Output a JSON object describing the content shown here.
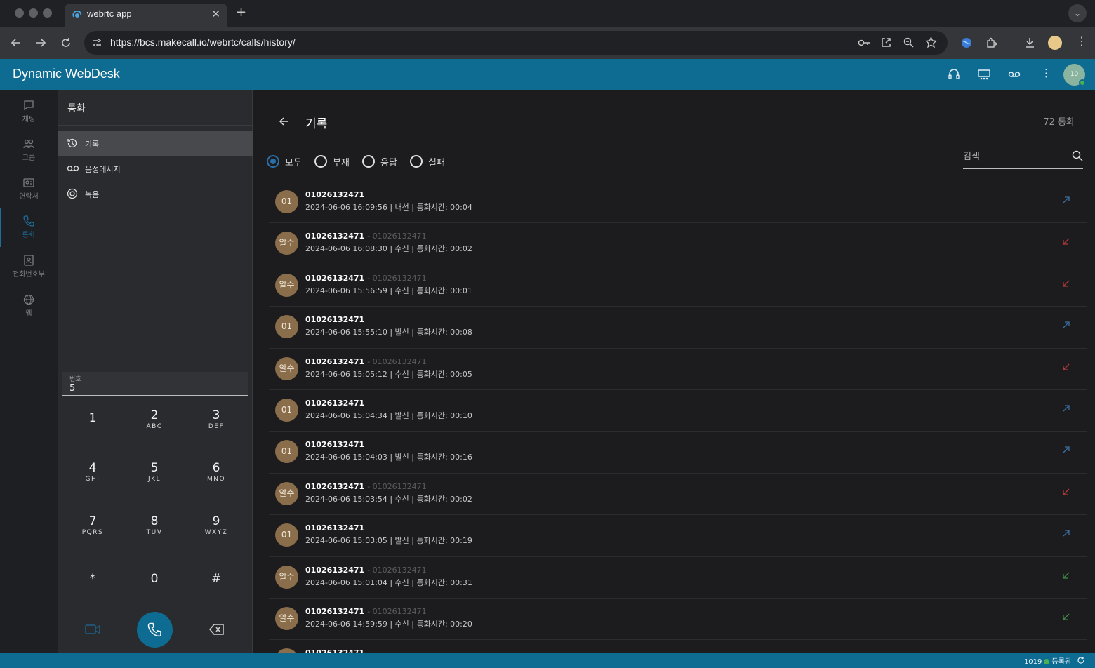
{
  "browser": {
    "tab_title": "webrtc app",
    "url": "https://bcs.makecall.io/webrtc/calls/history/"
  },
  "app": {
    "title": "Dynamic WebDesk",
    "avatar_text": "10"
  },
  "rail": {
    "items": [
      {
        "label": "채팅",
        "icon": "chat-icon"
      },
      {
        "label": "그룹",
        "icon": "group-icon"
      },
      {
        "label": "연락처",
        "icon": "contacts-icon"
      },
      {
        "label": "통화",
        "icon": "phone-icon"
      },
      {
        "label": "전화번호부",
        "icon": "phonebook-icon"
      },
      {
        "label": "웹",
        "icon": "globe-icon"
      }
    ]
  },
  "call_panel": {
    "title": "통화",
    "menu": [
      {
        "label": "기록",
        "icon": "history-icon"
      },
      {
        "label": "음성메시지",
        "icon": "voicemail-icon"
      },
      {
        "label": "녹음",
        "icon": "record-icon"
      }
    ],
    "number_label": "번호",
    "number_value": "5",
    "keys": [
      {
        "digit": "1",
        "letters": ""
      },
      {
        "digit": "2",
        "letters": "ABC"
      },
      {
        "digit": "3",
        "letters": "DEF"
      },
      {
        "digit": "4",
        "letters": "GHI"
      },
      {
        "digit": "5",
        "letters": "JKL"
      },
      {
        "digit": "6",
        "letters": "MNO"
      },
      {
        "digit": "7",
        "letters": "PQRS"
      },
      {
        "digit": "8",
        "letters": "TUV"
      },
      {
        "digit": "9",
        "letters": "WXYZ"
      },
      {
        "digit": "*",
        "letters": ""
      },
      {
        "digit": "0",
        "letters": ""
      },
      {
        "digit": "#",
        "letters": ""
      }
    ]
  },
  "main": {
    "title": "기록",
    "count": "72 통화",
    "filters": [
      {
        "label": "모두",
        "checked": true
      },
      {
        "label": "부재",
        "checked": false
      },
      {
        "label": "응답",
        "checked": false
      },
      {
        "label": "실패",
        "checked": false
      }
    ],
    "search_placeholder": "검색",
    "colors": {
      "outgoing": "#3b6fa3",
      "incoming_missed": "#b23a3a",
      "incoming_answered": "#3f8a46"
    },
    "calls": [
      {
        "avatar": "01",
        "name": "01026132471",
        "sub": "",
        "detail": "2024-06-06 16:09:56 | 내선 | 통화시간: 00:04",
        "direction": "outgoing"
      },
      {
        "avatar": "알수",
        "name": "01026132471",
        "sub": "- 01026132471",
        "detail": "2024-06-06 16:08:30 | 수신 | 통화시간: 00:02",
        "direction": "incoming_missed"
      },
      {
        "avatar": "알수",
        "name": "01026132471",
        "sub": "- 01026132471",
        "detail": "2024-06-06 15:56:59 | 수신 | 통화시간: 00:01",
        "direction": "incoming_missed"
      },
      {
        "avatar": "01",
        "name": "01026132471",
        "sub": "",
        "detail": "2024-06-06 15:55:10 | 발신 | 통화시간: 00:08",
        "direction": "outgoing"
      },
      {
        "avatar": "알수",
        "name": "01026132471",
        "sub": "- 01026132471",
        "detail": "2024-06-06 15:05:12 | 수신 | 통화시간: 00:05",
        "direction": "incoming_missed"
      },
      {
        "avatar": "01",
        "name": "01026132471",
        "sub": "",
        "detail": "2024-06-06 15:04:34 | 발신 | 통화시간: 00:10",
        "direction": "outgoing"
      },
      {
        "avatar": "01",
        "name": "01026132471",
        "sub": "",
        "detail": "2024-06-06 15:04:03 | 발신 | 통화시간: 00:16",
        "direction": "outgoing"
      },
      {
        "avatar": "알수",
        "name": "01026132471",
        "sub": "- 01026132471",
        "detail": "2024-06-06 15:03:54 | 수신 | 통화시간: 00:02",
        "direction": "incoming_missed"
      },
      {
        "avatar": "01",
        "name": "01026132471",
        "sub": "",
        "detail": "2024-06-06 15:03:05 | 발신 | 통화시간: 00:19",
        "direction": "outgoing"
      },
      {
        "avatar": "알수",
        "name": "01026132471",
        "sub": "- 01026132471",
        "detail": "2024-06-06 15:01:04 | 수신 | 통화시간: 00:31",
        "direction": "incoming_answered"
      },
      {
        "avatar": "알수",
        "name": "01026132471",
        "sub": "- 01026132471",
        "detail": "2024-06-06 14:59:59 | 수신 | 통화시간: 00:20",
        "direction": "incoming_answered"
      },
      {
        "avatar": "01",
        "name": "01026132471",
        "sub": "",
        "detail": "",
        "direction": "outgoing"
      }
    ]
  },
  "status": {
    "extension": "1019",
    "state": "등록됨"
  }
}
